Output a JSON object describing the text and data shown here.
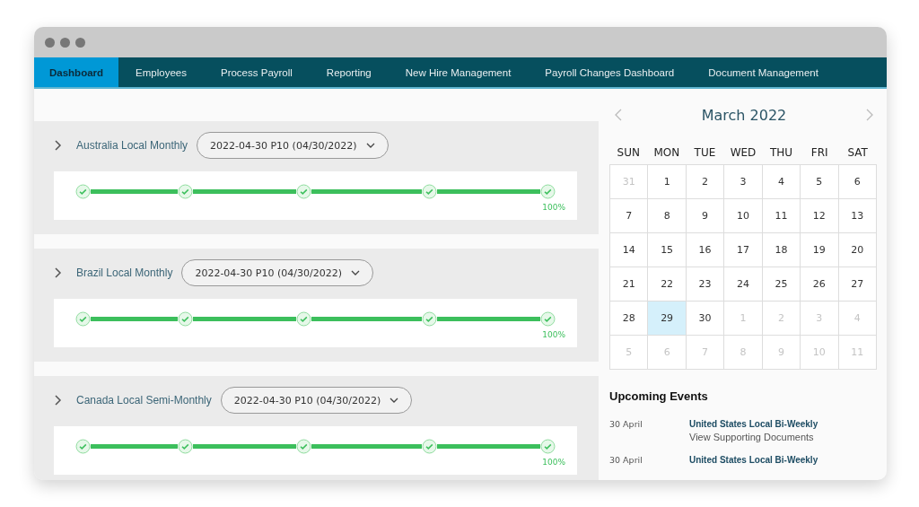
{
  "nav": [
    {
      "label": "Dashboard",
      "selected": true
    },
    {
      "label": "Employees",
      "selected": false
    },
    {
      "label": "Process Payroll",
      "selected": false
    },
    {
      "label": "Reporting",
      "selected": false
    },
    {
      "label": "New Hire Management",
      "selected": false
    },
    {
      "label": "Payroll Changes Dashboard",
      "selected": false
    },
    {
      "label": "Document Management",
      "selected": false
    }
  ],
  "payrolls": [
    {
      "name": "Australia Local Monthly",
      "period": "2022-04-30 P10 (04/30/2022)",
      "steps": [
        {
          "done": true
        },
        {
          "done": true
        },
        {
          "done": true
        },
        {
          "done": true
        },
        {
          "done": true
        }
      ],
      "percent": "100%"
    },
    {
      "name": "Brazil Local Monthly",
      "period": "2022-04-30 P10 (04/30/2022)",
      "steps": [
        {
          "done": true
        },
        {
          "done": true
        },
        {
          "done": true
        },
        {
          "done": true
        },
        {
          "done": true
        }
      ],
      "percent": "100%"
    },
    {
      "name": "Canada Local Semi-Monthly",
      "period": "2022-04-30 P10 (04/30/2022)",
      "steps": [
        {
          "done": true
        },
        {
          "done": true
        },
        {
          "done": true
        },
        {
          "done": true
        },
        {
          "done": true
        }
      ],
      "percent": "100%"
    }
  ],
  "calendar": {
    "month": "March 2022",
    "weekdays": [
      "SUN",
      "MON",
      "TUE",
      "WED",
      "THU",
      "FRI",
      "SAT"
    ],
    "days": [
      {
        "label": "31",
        "muted": true,
        "selected": false
      },
      {
        "label": "1",
        "muted": false,
        "selected": false
      },
      {
        "label": "2",
        "muted": false,
        "selected": false
      },
      {
        "label": "3",
        "muted": false,
        "selected": false
      },
      {
        "label": "4",
        "muted": false,
        "selected": false
      },
      {
        "label": "5",
        "muted": false,
        "selected": false
      },
      {
        "label": "6",
        "muted": false,
        "selected": false
      },
      {
        "label": "7",
        "muted": false,
        "selected": false
      },
      {
        "label": "8",
        "muted": false,
        "selected": false
      },
      {
        "label": "9",
        "muted": false,
        "selected": false
      },
      {
        "label": "10",
        "muted": false,
        "selected": false
      },
      {
        "label": "11",
        "muted": false,
        "selected": false
      },
      {
        "label": "12",
        "muted": false,
        "selected": false
      },
      {
        "label": "13",
        "muted": false,
        "selected": false
      },
      {
        "label": "14",
        "muted": false,
        "selected": false
      },
      {
        "label": "15",
        "muted": false,
        "selected": false
      },
      {
        "label": "16",
        "muted": false,
        "selected": false
      },
      {
        "label": "17",
        "muted": false,
        "selected": false
      },
      {
        "label": "18",
        "muted": false,
        "selected": false
      },
      {
        "label": "19",
        "muted": false,
        "selected": false
      },
      {
        "label": "20",
        "muted": false,
        "selected": false
      },
      {
        "label": "21",
        "muted": false,
        "selected": false
      },
      {
        "label": "22",
        "muted": false,
        "selected": false
      },
      {
        "label": "23",
        "muted": false,
        "selected": false
      },
      {
        "label": "24",
        "muted": false,
        "selected": false
      },
      {
        "label": "25",
        "muted": false,
        "selected": false
      },
      {
        "label": "26",
        "muted": false,
        "selected": false
      },
      {
        "label": "27",
        "muted": false,
        "selected": false
      },
      {
        "label": "28",
        "muted": false,
        "selected": false
      },
      {
        "label": "29",
        "muted": false,
        "selected": true
      },
      {
        "label": "30",
        "muted": false,
        "selected": false
      },
      {
        "label": "1",
        "muted": true,
        "selected": false
      },
      {
        "label": "2",
        "muted": true,
        "selected": false
      },
      {
        "label": "3",
        "muted": true,
        "selected": false
      },
      {
        "label": "4",
        "muted": true,
        "selected": false
      },
      {
        "label": "5",
        "muted": true,
        "selected": false
      },
      {
        "label": "6",
        "muted": true,
        "selected": false
      },
      {
        "label": "7",
        "muted": true,
        "selected": false
      },
      {
        "label": "8",
        "muted": true,
        "selected": false
      },
      {
        "label": "9",
        "muted": true,
        "selected": false
      },
      {
        "label": "10",
        "muted": true,
        "selected": false
      },
      {
        "label": "11",
        "muted": true,
        "selected": false
      }
    ]
  },
  "events": {
    "title": "Upcoming Events",
    "items": [
      {
        "date": "30 April",
        "title": "United States Local Bi-Weekly",
        "detail": "View Supporting Documents"
      },
      {
        "date": "30 April",
        "title": "United States Local Bi-Weekly"
      }
    ]
  }
}
